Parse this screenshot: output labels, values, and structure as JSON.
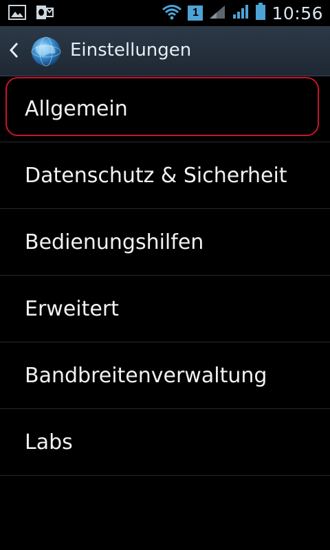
{
  "status_bar": {
    "time": "10:56",
    "sim_label": "1",
    "icons": [
      "gallery-icon",
      "outlook-icon",
      "wifi-icon",
      "signal-icon",
      "signal-icon",
      "battery-icon"
    ]
  },
  "action_bar": {
    "title": "Einstellungen",
    "back_icon": "chevron-left-icon",
    "app_icon": "globe-icon"
  },
  "settings": {
    "items": [
      {
        "label": "Allgemein",
        "selected": true
      },
      {
        "label": "Datenschutz & Sicherheit"
      },
      {
        "label": "Bedienungshilfen"
      },
      {
        "label": "Erweitert"
      },
      {
        "label": "Bandbreitenverwaltung"
      },
      {
        "label": "Labs"
      }
    ]
  },
  "colors": {
    "background": "#000000",
    "action_bar": "#26313c",
    "selection_outline": "#c8152c",
    "status_accent": "#4ea3d6"
  }
}
